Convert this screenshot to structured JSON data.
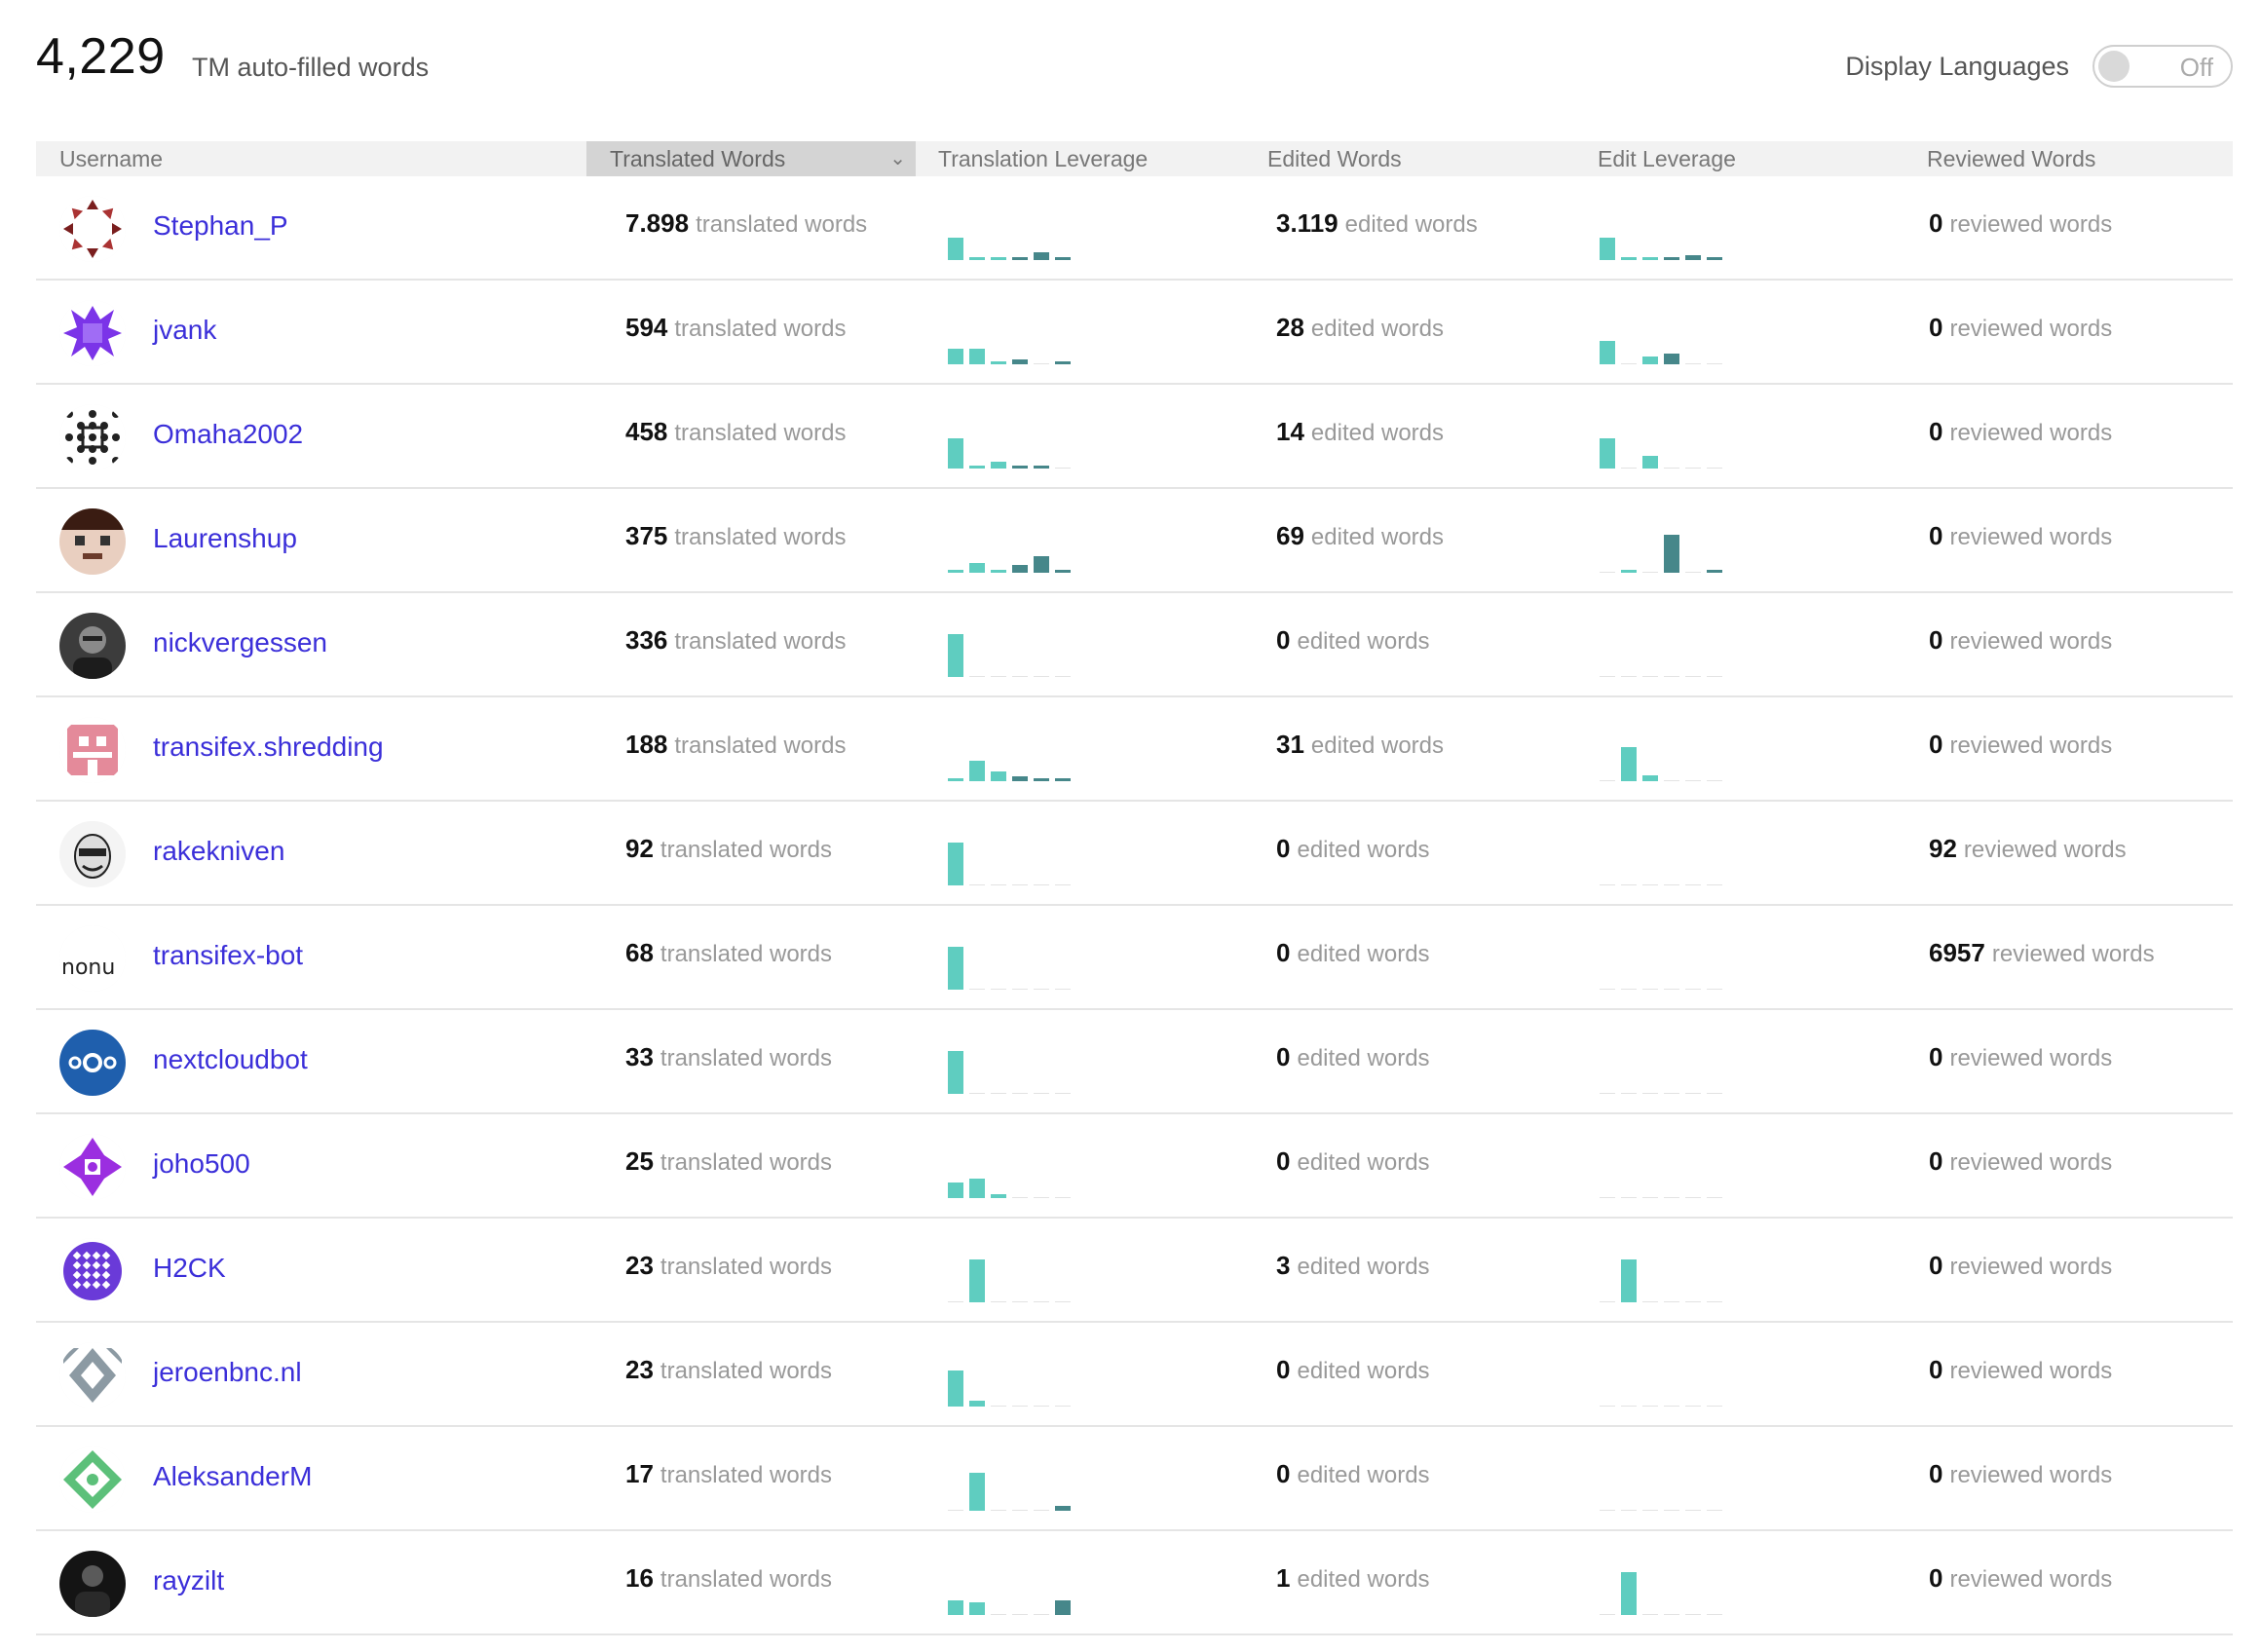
{
  "summary": {
    "count": "4,229",
    "label": "TM auto-filled words"
  },
  "display_languages": {
    "label": "Display Languages",
    "state": "Off"
  },
  "colors": {
    "light_bar": "#5fcdc0",
    "dark_bar": "#46878a",
    "link": "#3b2fd9"
  },
  "columns": {
    "username": "Username",
    "translated": "Translated Words",
    "translation_leverage": "Translation Leverage",
    "edited": "Edited Words",
    "edit_leverage": "Edit Leverage",
    "reviewed": "Reviewed Words"
  },
  "units": {
    "translated": "translated words",
    "edited": "edited words",
    "reviewed": "reviewed words"
  },
  "users": [
    {
      "name": "Stephan_P",
      "avatar": "crimson-ring-identicon",
      "translated": "7.898",
      "edited": "3.119",
      "reviewed": "0",
      "t_lev": [
        0.45,
        0.06,
        0.06,
        0.06,
        0.15,
        0.06
      ],
      "e_lev": [
        0.45,
        0.06,
        0.06,
        0.06,
        0.1,
        0.06
      ]
    },
    {
      "name": "jvank",
      "avatar": "purple-spiky-identicon",
      "translated": "594",
      "edited": "28",
      "reviewed": "0",
      "t_lev": [
        0.32,
        0.32,
        0.06,
        0.1,
        0,
        0.06
      ],
      "e_lev": [
        0.48,
        0,
        0.16,
        0.22,
        0,
        0
      ]
    },
    {
      "name": "Omaha2002",
      "avatar": "black-dots-identicon",
      "translated": "458",
      "edited": "14",
      "reviewed": "0",
      "t_lev": [
        0.62,
        0.06,
        0.14,
        0.06,
        0.06,
        0
      ],
      "e_lev": [
        0.62,
        0,
        0.26,
        0,
        0,
        0
      ]
    },
    {
      "name": "Laurenshup",
      "avatar": "pixel-face-avatar",
      "translated": "375",
      "edited": "69",
      "reviewed": "0",
      "t_lev": [
        0.06,
        0.2,
        0.06,
        0.16,
        0.34,
        0.06
      ],
      "e_lev": [
        0,
        0.06,
        0,
        0.78,
        0,
        0.06
      ]
    },
    {
      "name": "nickvergessen",
      "avatar": "photo-avatar",
      "translated": "336",
      "edited": "0",
      "reviewed": "0",
      "t_lev": [
        0.88,
        0,
        0,
        0,
        0,
        0
      ],
      "e_lev": [
        0,
        0,
        0,
        0,
        0,
        0
      ]
    },
    {
      "name": "transifex.shredding",
      "avatar": "pink-grid-identicon",
      "translated": "188",
      "edited": "31",
      "reviewed": "0",
      "t_lev": [
        0.06,
        0.42,
        0.2,
        0.1,
        0.06,
        0.06
      ],
      "e_lev": [
        0,
        0.7,
        0.12,
        0,
        0,
        0
      ]
    },
    {
      "name": "rakekniven",
      "avatar": "cartoon-face-avatar",
      "translated": "92",
      "edited": "0",
      "reviewed": "92",
      "t_lev": [
        0.88,
        0,
        0,
        0,
        0,
        0
      ],
      "e_lev": [
        0,
        0,
        0,
        0,
        0,
        0
      ]
    },
    {
      "name": "transifex-bot",
      "avatar": "text-logo-avatar",
      "avatar_text": "nonu",
      "translated": "68",
      "edited": "0",
      "reviewed": "6957",
      "t_lev": [
        0.88,
        0,
        0,
        0,
        0,
        0
      ],
      "e_lev": [
        0,
        0,
        0,
        0,
        0,
        0
      ]
    },
    {
      "name": "nextcloudbot",
      "avatar": "nextcloud-logo-avatar",
      "translated": "33",
      "edited": "0",
      "reviewed": "0",
      "t_lev": [
        0.88,
        0,
        0,
        0,
        0,
        0
      ],
      "e_lev": [
        0,
        0,
        0,
        0,
        0,
        0
      ]
    },
    {
      "name": "joho500",
      "avatar": "violet-star-identicon",
      "translated": "25",
      "edited": "0",
      "reviewed": "0",
      "t_lev": [
        0.32,
        0.4,
        0.08,
        0,
        0,
        0
      ],
      "e_lev": [
        0,
        0,
        0,
        0,
        0,
        0
      ]
    },
    {
      "name": "H2CK",
      "avatar": "purple-circle-identicon",
      "translated": "23",
      "edited": "3",
      "reviewed": "0",
      "t_lev": [
        0,
        0.88,
        0,
        0,
        0,
        0
      ],
      "e_lev": [
        0,
        0.88,
        0,
        0,
        0,
        0
      ]
    },
    {
      "name": "jeroenbnc.nl",
      "avatar": "gray-triangles-identicon",
      "translated": "23",
      "edited": "0",
      "reviewed": "0",
      "t_lev": [
        0.74,
        0.12,
        0,
        0,
        0,
        0
      ],
      "e_lev": [
        0,
        0,
        0,
        0,
        0,
        0
      ]
    },
    {
      "name": "AleksanderM",
      "avatar": "green-pattern-identicon",
      "translated": "17",
      "edited": "0",
      "reviewed": "0",
      "t_lev": [
        0,
        0.78,
        0,
        0,
        0,
        0.1
      ],
      "e_lev": [
        0,
        0,
        0,
        0,
        0,
        0
      ]
    },
    {
      "name": "rayzilt",
      "avatar": "dark-photo-avatar",
      "translated": "16",
      "edited": "1",
      "reviewed": "0",
      "t_lev": [
        0.3,
        0.26,
        0,
        0,
        0,
        0.3
      ],
      "e_lev": [
        0,
        0.88,
        0,
        0,
        0,
        0
      ]
    }
  ]
}
